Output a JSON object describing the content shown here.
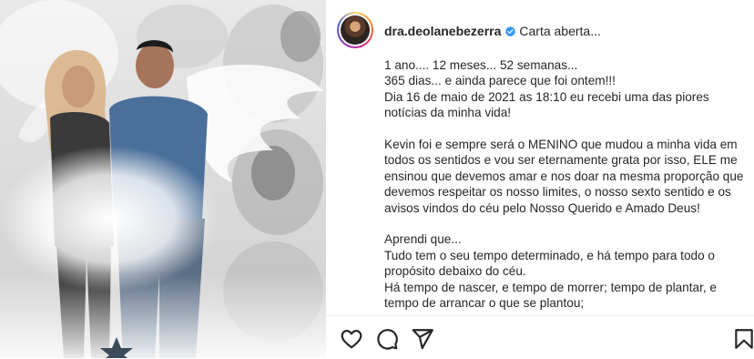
{
  "post": {
    "username": "dra.deolanebezerra",
    "header_text": "Carta aberta...",
    "caption_lines": [
      "1 ano.... 12 meses... 52 semanas...",
      "365 dias... e ainda parece que foi ontem!!!",
      "Dia 16 de maio de 2021 as 18:10 eu recebi uma das piores notícias da minha vida!",
      "",
      "Kevin foi e sempre será o MENINO que mudou a minha vida em todos os sentidos e vou ser eternamente grata por isso, ELE me ensinou que devemos amar e nos doar na mesma proporção que devemos respeitar os nosso limites, o nosso sexto sentido e os avisos vindos do céu pelo Nosso Querido e Amado Deus!",
      "",
      "Aprendi que...",
      "Tudo tem o seu tempo determinado, e há tempo para todo o propósito debaixo do céu.",
      "Há tempo de nascer, e tempo de morrer; tempo de plantar, e tempo de arrancar o que se plantou;"
    ]
  },
  "icons": {
    "like": "heart-icon",
    "comment": "comment-icon",
    "share": "share-icon",
    "save": "bookmark-icon",
    "verified": "verified-badge-icon"
  },
  "colors": {
    "verified": "#3897f0",
    "text": "#262626"
  }
}
